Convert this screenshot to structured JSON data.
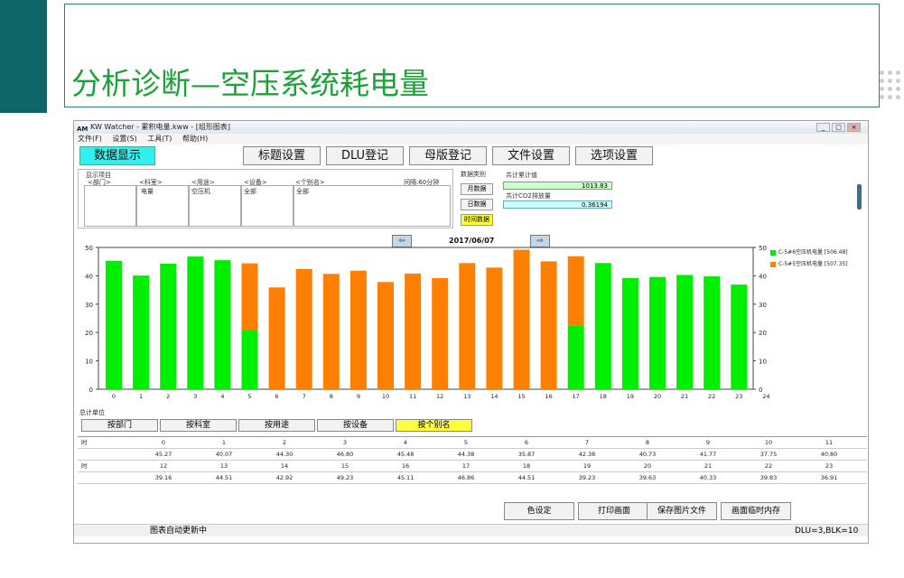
{
  "slide": {
    "title": "分析诊断—空压系统耗电量"
  },
  "window": {
    "title": "KW Watcher - 累积电量.kww - [组形图表]",
    "app_icon": "AM",
    "controls": [
      "_",
      "□",
      "×"
    ]
  },
  "menu": [
    "文件(F)",
    "设置(S)",
    "工具(T)",
    "帮助(H)"
  ],
  "toolbar": {
    "data_display": "数据显示",
    "title_settings": "标题设置",
    "dlu_register": "DLU登记",
    "board_register": "母版登记",
    "file_settings": "文件设置",
    "option_settings": "选项设置"
  },
  "display": {
    "group_label": "显示项目",
    "dept_label": "<部门>",
    "section_label": "<科室>",
    "section_value": "电量",
    "usage_label": "<用途>",
    "usage_value": "空压机",
    "device_label": "<设备>",
    "device_value": "全部",
    "alias_label": "<个别名>",
    "alias_value": "全部",
    "interval": "间隔:60分钟"
  },
  "data_type": {
    "label": "数据类别",
    "monthly": "月数据",
    "daily": "日数据",
    "hourly": "时间数据"
  },
  "totals": {
    "power_label": "共计累计值",
    "power_value": "1013.83",
    "co2_label": "共计CO2排放量",
    "co2_value": "0.36194"
  },
  "chart_nav": {
    "prev": "⇦",
    "next": "⇨",
    "date": "2017/06/07"
  },
  "chart_data": {
    "type": "bar",
    "stacked": true,
    "categories": [
      "0",
      "1",
      "2",
      "3",
      "4",
      "5",
      "6",
      "7",
      "8",
      "9",
      "10",
      "11",
      "12",
      "13",
      "14",
      "15",
      "16",
      "17",
      "18",
      "19",
      "20",
      "21",
      "22",
      "23",
      "24"
    ],
    "series": [
      {
        "name": "C-5#6空压机电量 [506.48]",
        "color": "#00ee00",
        "values": [
          45.3,
          40.1,
          44.3,
          46.8,
          45.5,
          21.0,
          0,
          0,
          0,
          0,
          0,
          0,
          0,
          0,
          0,
          0,
          0,
          22.5,
          44.5,
          39.2,
          39.6,
          40.3,
          39.8,
          36.9,
          0
        ]
      },
      {
        "name": "C-5#5空压机电量 [507.35]",
        "color": "#ff8000",
        "values": [
          0,
          0,
          0,
          0,
          0,
          23.4,
          35.9,
          42.4,
          40.7,
          41.8,
          37.8,
          40.8,
          39.2,
          44.5,
          42.9,
          49.2,
          45.1,
          24.4,
          0,
          0,
          0,
          0,
          0,
          0,
          0
        ]
      }
    ],
    "ylim": [
      0,
      50
    ],
    "yticks": [
      0,
      10,
      20,
      30,
      40,
      50
    ],
    "grid": false,
    "legend": "right"
  },
  "summary": {
    "label": "总计单位",
    "buttons": [
      "按部门",
      "按科室",
      "按用途",
      "按设备",
      "按个别名"
    ]
  },
  "table": {
    "row_label": "时",
    "hours1": [
      "0",
      "1",
      "2",
      "3",
      "4",
      "5",
      "6",
      "7",
      "8",
      "9",
      "10",
      "11"
    ],
    "values1": [
      "45.27",
      "40.07",
      "44.30",
      "46.80",
      "45.48",
      "44.38",
      "35.87",
      "42.38",
      "40.73",
      "41.77",
      "37.75",
      "40.80"
    ],
    "hours2": [
      "12",
      "13",
      "14",
      "15",
      "16",
      "17",
      "18",
      "19",
      "20",
      "21",
      "22",
      "23"
    ],
    "values2": [
      "39.16",
      "44.51",
      "42.92",
      "49.23",
      "45.11",
      "46.86",
      "44.51",
      "39.23",
      "39.63",
      "40.33",
      "39.83",
      "36.91"
    ]
  },
  "bottom_buttons": {
    "color_settings": "色设定",
    "print_screen": "打印画面",
    "save_image": "保存图片文件",
    "screen_to_memory": "画面临时内存"
  },
  "status": {
    "left": "图表自动更新中",
    "right": "DLU=3,BLK=10"
  }
}
